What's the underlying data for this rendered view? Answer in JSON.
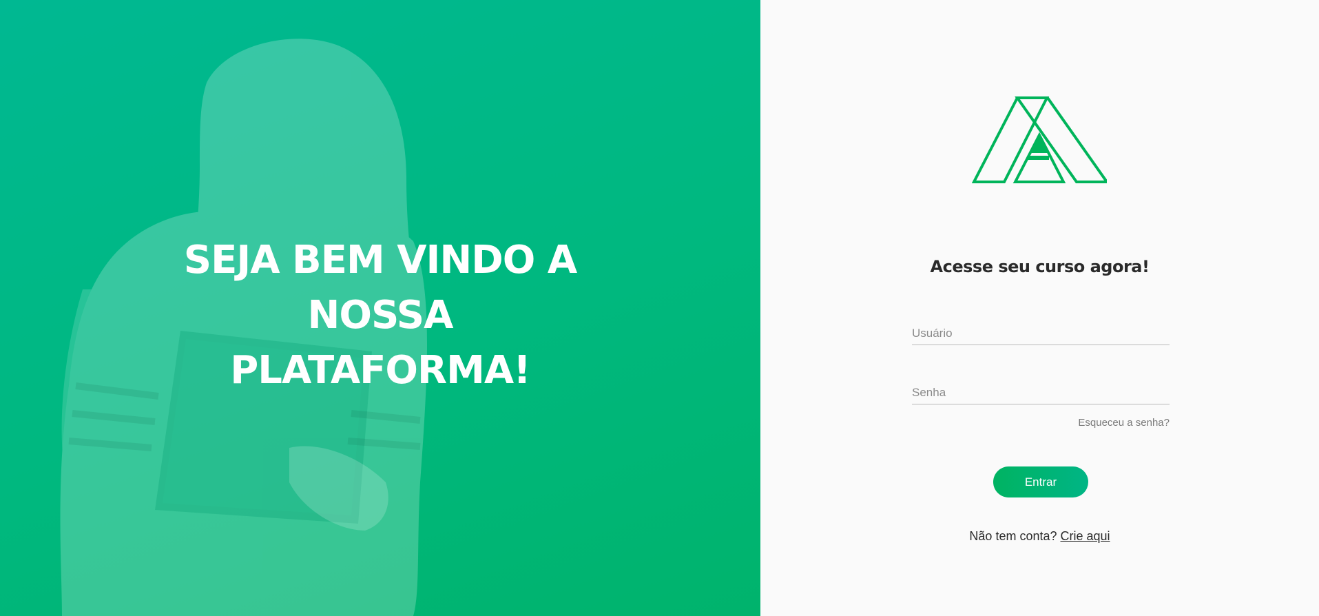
{
  "hero": {
    "title_lines": [
      "SEJA BEM VINDO A",
      "NOSSA",
      "PLATAFORMA!"
    ],
    "background_color": "#00b880",
    "photo": "woman-holding-tablet-photo"
  },
  "login": {
    "logo_icon": "triangle-a-logo",
    "logo_color": "#00b45a",
    "heading": "Acesse seu curso agora!",
    "username_placeholder": "Usuário",
    "username_value": "",
    "password_placeholder": "Senha",
    "password_value": "",
    "forgot_password": "Esqueceu a senha?",
    "submit_label": "Entrar",
    "signup_prompt": "Não tem conta?",
    "signup_link": "Crie aqui",
    "accent_color": "#00b362"
  }
}
